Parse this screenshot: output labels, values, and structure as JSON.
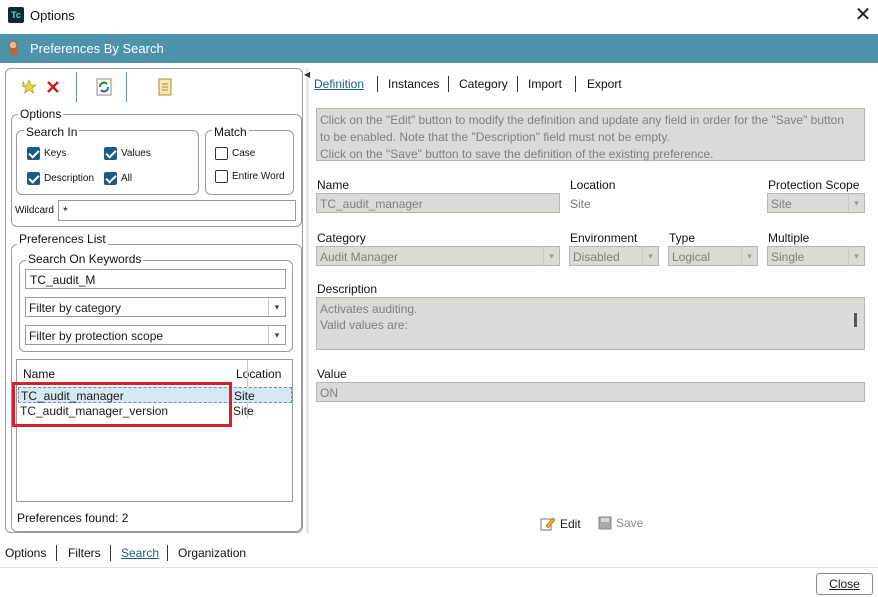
{
  "window": {
    "title": "Options",
    "close_glyph": "✕",
    "app_icon_text": "Tc"
  },
  "header": {
    "title": "Preferences By Search"
  },
  "toolbar": {
    "icons": [
      "star-icon",
      "delete-x-icon",
      "refresh-icon",
      "document-icon"
    ]
  },
  "options": {
    "legend": "Options",
    "search_in": {
      "legend": "Search In",
      "items": [
        {
          "label": "Keys",
          "checked": true
        },
        {
          "label": "Values",
          "checked": true
        },
        {
          "label": "Description",
          "checked": true
        },
        {
          "label": "All",
          "checked": true
        }
      ]
    },
    "match": {
      "legend": "Match",
      "items": [
        {
          "label": "Case",
          "checked": false
        },
        {
          "label": "Entire Word",
          "checked": false
        }
      ]
    },
    "wildcard_label": "Wildcard",
    "wildcard_value": "*"
  },
  "prefs_list": {
    "legend": "Preferences List",
    "keywords_legend": "Search On Keywords",
    "keyword_value": "TC_audit_M",
    "category_filter": "Filter by category",
    "scope_filter": "Filter by protection scope",
    "columns": [
      "Name",
      "Location"
    ],
    "rows": [
      {
        "name": "TC_audit_manager",
        "location": "Site",
        "selected": true
      },
      {
        "name": "TC_audit_manager_version",
        "location": "Site",
        "selected": false
      }
    ],
    "found_text": "Preferences found: 2"
  },
  "tabs": [
    "Definition",
    "Instances",
    "Category",
    "Import",
    "Export"
  ],
  "definition": {
    "info_lines": [
      "Click on the \"Edit\" button to modify the definition and update any field in order for the \"Save\" button",
      "to be enabled. Note that the \"Description\" field must not be empty.",
      "Click on the \"Save\" button to save the definition of the existing preference."
    ],
    "name_label": "Name",
    "name_value": "TC_audit_manager",
    "location_label": "Location",
    "location_value": "Site",
    "scope_label": "Protection Scope",
    "scope_value": "Site",
    "category_label": "Category",
    "category_value": "Audit Manager",
    "environment_label": "Environment",
    "environment_value": "Disabled",
    "type_label": "Type",
    "type_value": "Logical",
    "multiple_label": "Multiple",
    "multiple_value": "Single",
    "description_label": "Description",
    "description_lines": [
      "Activates auditing.",
      "Valid values are:"
    ],
    "value_label": "Value",
    "value_value": "ON",
    "edit_label": "Edit",
    "save_label": "Save"
  },
  "bottom_nav": [
    "Options",
    "Filters",
    "Search",
    "Organization"
  ],
  "close_button": "Close",
  "colors": {
    "header": "#4e93ac",
    "accent": "#1a5c86",
    "highlight": "#d9202a",
    "readonly_bg": "#dcdad7"
  }
}
